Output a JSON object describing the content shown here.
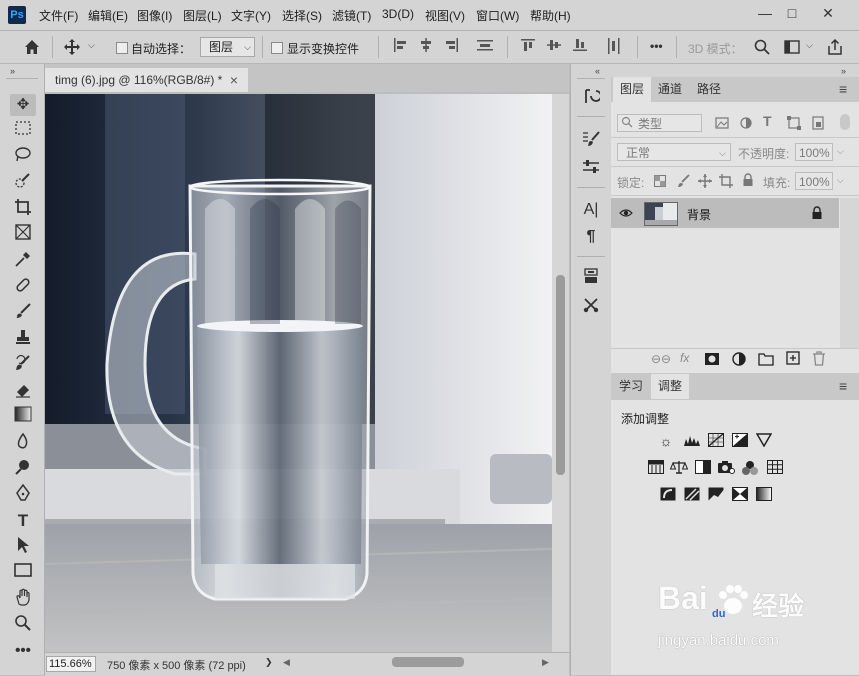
{
  "app": {
    "logo": "Ps"
  },
  "menu": [
    "文件(F)",
    "编辑(E)",
    "图像(I)",
    "图层(L)",
    "文字(Y)",
    "选择(S)",
    "滤镜(T)",
    "3D(D)",
    "视图(V)",
    "窗口(W)",
    "帮助(H)"
  ],
  "window_controls": {
    "minimize": "—",
    "maximize": "□",
    "close": "✕"
  },
  "options": {
    "auto_select_label": "自动选择：",
    "auto_select_target": "图层",
    "show_transform_label": "显示变换控件",
    "more": "•••",
    "mode_3d": "3D 模式："
  },
  "document": {
    "tab_title": "timg (6).jpg @ 116%(RGB/8#) *",
    "tab_close": "×",
    "zoom": "115.66%",
    "doc_info": "750 像素 x 500 像素 (72 ppi)",
    "doc_info_arrow": "❯"
  },
  "layers_panel": {
    "tabs": [
      "图层",
      "通道",
      "路径"
    ],
    "filter_kind": "类型",
    "blend_mode": "正常",
    "opacity_label": "不透明度:",
    "opacity_value": "100%",
    "lock_label": "锁定:",
    "fill_label": "填充:",
    "fill_value": "100%",
    "layer_name": "背景"
  },
  "adjust_panel": {
    "tabs": [
      "学习",
      "调整"
    ],
    "title": "添加调整"
  },
  "watermark": {
    "brand": "Bai",
    "brand2": "du",
    "cn": "经验",
    "url": "jingyan.baidu.com"
  }
}
